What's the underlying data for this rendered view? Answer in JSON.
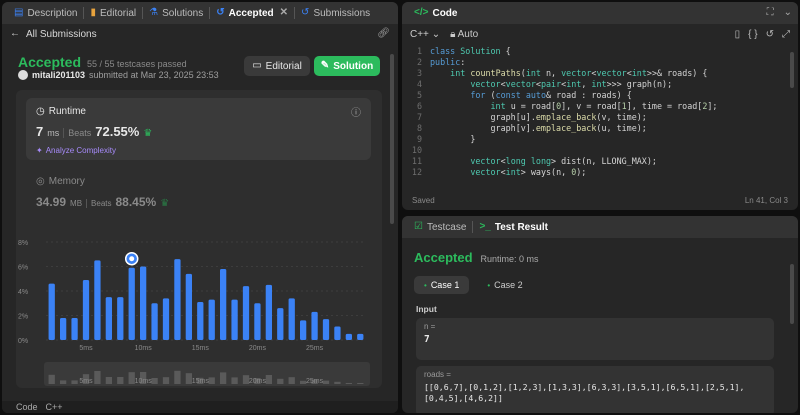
{
  "left_tabs": [
    {
      "label": "Description",
      "icon": "description-icon"
    },
    {
      "label": "Editorial",
      "icon": "editorial-icon"
    },
    {
      "label": "Solutions",
      "icon": "flask-icon"
    },
    {
      "label": "Accepted",
      "icon": "history-icon"
    },
    {
      "label": "Submissions",
      "icon": "history-icon"
    }
  ],
  "nav": {
    "back_label": "All Submissions"
  },
  "submission": {
    "status": "Accepted",
    "testcases": "55 / 55 testcases passed",
    "user": "mitali201103",
    "submitted_text": "submitted at Mar 23, 2025 23:53",
    "editorial_btn": "Editorial",
    "solution_btn": "Solution"
  },
  "runtime": {
    "label": "Runtime",
    "value": "7",
    "unit": "ms",
    "beats_label": "Beats",
    "beats_pct": "72.55%",
    "analyze": "Analyze Complexity"
  },
  "memory": {
    "label": "Memory",
    "value": "34.99",
    "unit": "MB",
    "beats_label": "Beats",
    "beats_pct": "88.45%"
  },
  "chart_data": {
    "type": "bar",
    "ylabel": "",
    "yticks": [
      "8%",
      "6%",
      "4%",
      "2%",
      "0%"
    ],
    "ylim": [
      0,
      8
    ],
    "xticks": [
      "5ms",
      "10ms",
      "15ms",
      "20ms",
      "25ms"
    ],
    "x": [
      1,
      2,
      3,
      4,
      5,
      6,
      7,
      8,
      9,
      10,
      11,
      12,
      13,
      14,
      15,
      16,
      17,
      18,
      19,
      20,
      21,
      22,
      23,
      24,
      25,
      26,
      27,
      28
    ],
    "values": [
      4.6,
      1.8,
      1.8,
      4.9,
      6.5,
      3.5,
      3.5,
      5.9,
      6.0,
      3.0,
      3.4,
      6.6,
      5.4,
      3.1,
      3.3,
      5.8,
      3.3,
      4.4,
      3.0,
      4.5,
      2.6,
      3.4,
      1.6,
      2.3,
      1.7,
      1.1,
      0.5,
      0.5
    ],
    "highlight_index": 7,
    "bar_color": "#3b82f6"
  },
  "left_footer": {
    "items": [
      "Code",
      "C++"
    ]
  },
  "code": {
    "title": "Code",
    "language": "C++",
    "mode": "Auto",
    "saved_label": "Saved",
    "cursor": "Ln 41, Col 3",
    "lines": [
      "class Solution {",
      "public:",
      "    int countPaths(int n, vector<vector<int>>& roads) {",
      "        vector<vector<pair<int, int>>> graph(n);",
      "        for (const auto& road : roads) {",
      "            int u = road[0], v = road[1], time = road[2];",
      "            graph[u].emplace_back(v, time);",
      "            graph[v].emplace_back(u, time);",
      "        }",
      "",
      "        vector<long long> dist(n, LLONG_MAX);",
      "        vector<int> ways(n, 0);"
    ]
  },
  "result": {
    "tab_testcase": "Testcase",
    "tab_result": "Test Result",
    "status": "Accepted",
    "runtime": "Runtime: 0 ms",
    "cases": [
      "Case 1",
      "Case 2"
    ],
    "input_label": "Input",
    "vars": [
      {
        "name": "n =",
        "value": "7"
      },
      {
        "name": "roads =",
        "value": "[[0,6,7],[0,1,2],[1,2,3],[1,3,3],[6,3,3],[3,5,1],[6,5,1],[2,5,1],[0,4,5],[4,6,2]]"
      }
    ]
  }
}
